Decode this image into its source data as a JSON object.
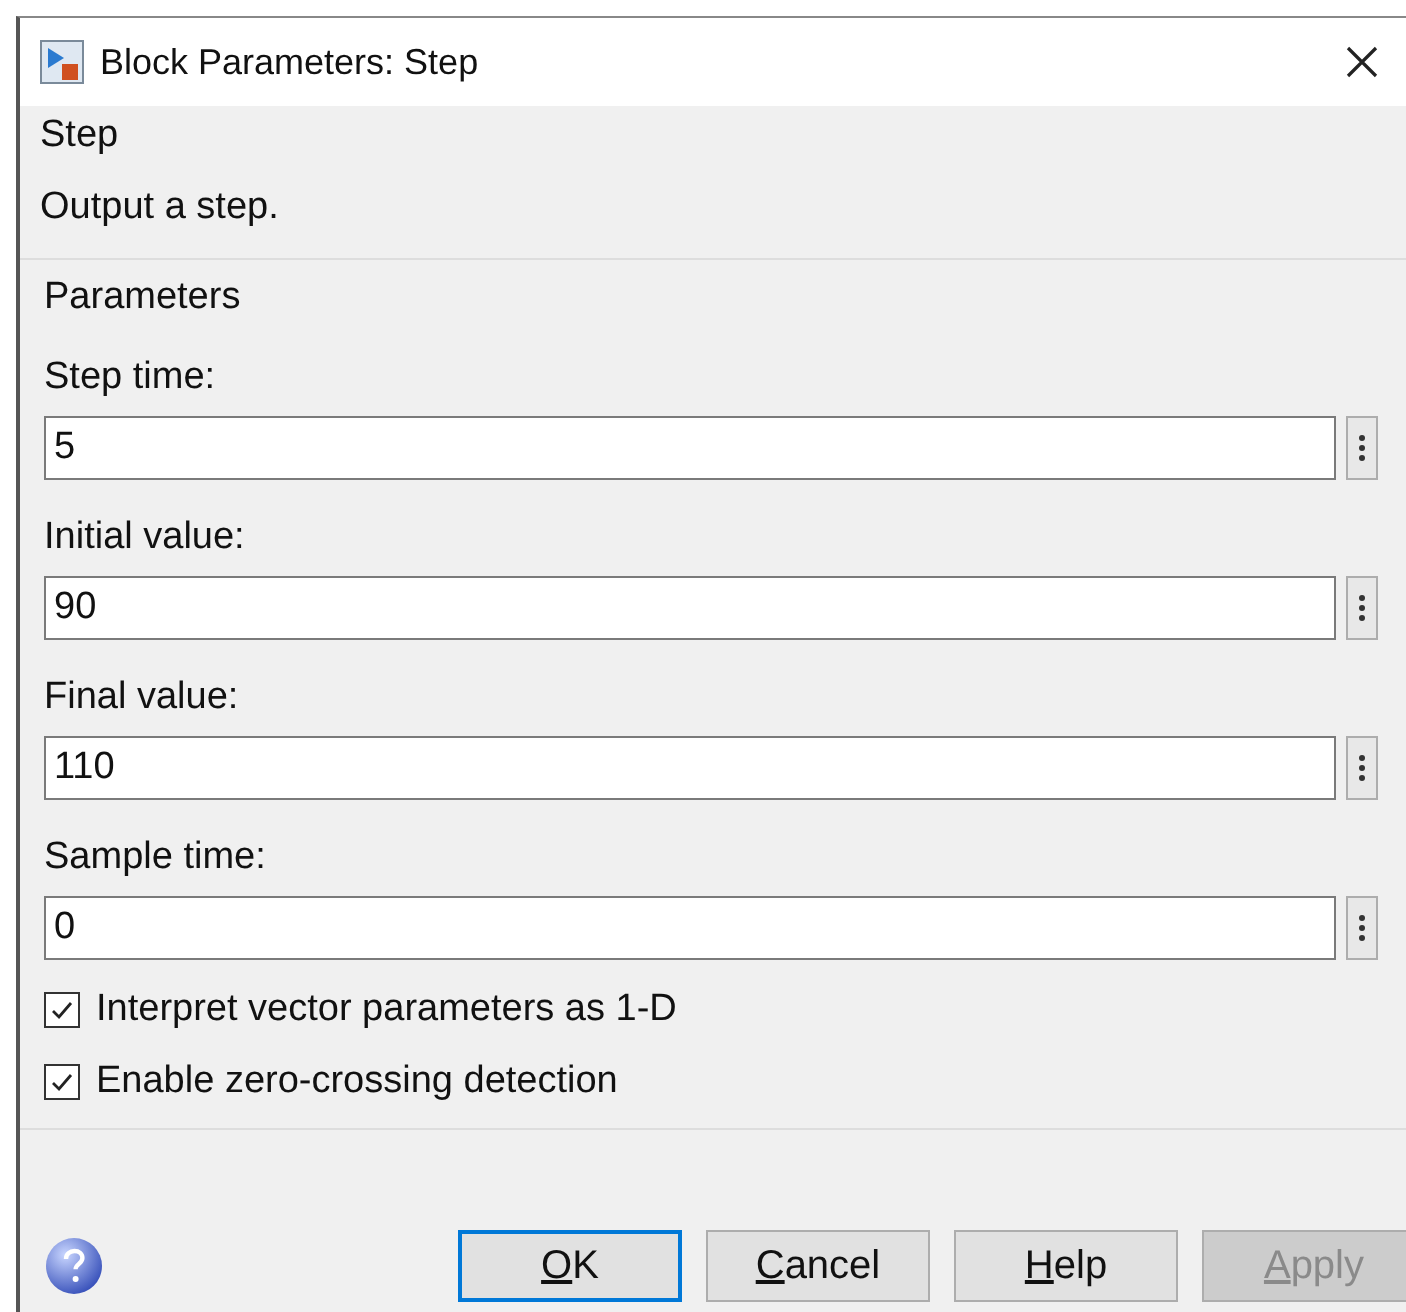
{
  "window": {
    "title": "Block Parameters: Step"
  },
  "block": {
    "name": "Step",
    "description": "Output a step."
  },
  "parameters": {
    "title": "Parameters",
    "fields": [
      {
        "label": "Step time:",
        "value": "5"
      },
      {
        "label": "Initial value:",
        "value": "90"
      },
      {
        "label": "Final value:",
        "value": "110"
      },
      {
        "label": "Sample time:",
        "value": "0"
      }
    ],
    "checkboxes": [
      {
        "label": "Interpret vector parameters as 1-D",
        "checked": true
      },
      {
        "label": "Enable zero-crossing detection",
        "checked": true
      }
    ]
  },
  "buttons": [
    {
      "label": "OK",
      "default": true,
      "disabled": false
    },
    {
      "label": "Cancel",
      "default": false,
      "disabled": false
    },
    {
      "label": "Help",
      "default": false,
      "disabled": false
    },
    {
      "label": "Apply",
      "default": false,
      "disabled": true
    }
  ]
}
